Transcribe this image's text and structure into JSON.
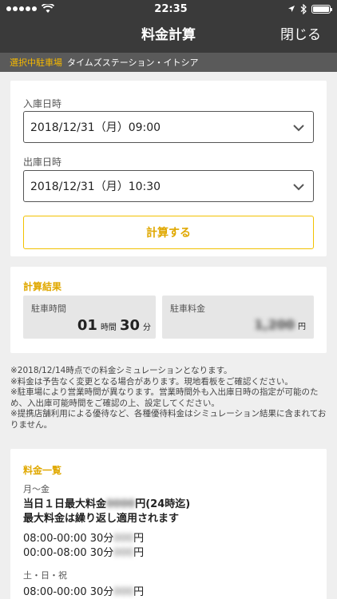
{
  "status_bar": {
    "time": "22:35"
  },
  "nav": {
    "title": "料金計算",
    "close_label": "閉じる"
  },
  "lot": {
    "tag": "選択中駐車場",
    "name": "タイムズステーション・イトシア"
  },
  "entry": {
    "label": "入庫日時",
    "value": "2018/12/31（月）09:00"
  },
  "exit": {
    "label": "出庫日時",
    "value": "2018/12/31（月）10:30"
  },
  "calc_button_label": "計算する",
  "result": {
    "title": "計算結果",
    "duration_label": "駐車時間",
    "hours": "01",
    "hours_unit": "時間",
    "minutes": "30",
    "minutes_unit": "分",
    "fee_label": "駐車料金",
    "fee_value": "1,200",
    "fee_unit": "円"
  },
  "notes": [
    "※2018/12/14時点での料金シミュレーションとなります。",
    "※料金は予告なく変更となる場合があります。現地看板をご確認ください。",
    "※駐車場により営業時間が異なります。営業時間外も入出庫日時の指定が可能のため、入出庫可能時間をご確認の上、設定してください。",
    "※提携店舗利用による優待など、各種優待料金はシミュレーション結果に含まれておりません。"
  ],
  "price_list": {
    "title": "料金一覧",
    "weekday_label": "月〜金",
    "max_prefix": "当日１日最大料金",
    "max_amount": "0000",
    "max_suffix": "円(24時迄)",
    "repeat_note": "最大料金は繰り返し適用されます",
    "rate1_prefix": "08:00-00:00 30分",
    "rate1_amount": "000",
    "rate1_suffix": "円",
    "rate2_prefix": "00:00-08:00 30分",
    "rate2_amount": "000",
    "rate2_suffix": "円",
    "weekend_label": "土・日・祝",
    "rate3_prefix": "08:00-00:00 30分",
    "rate3_amount": "000",
    "rate3_suffix": "円"
  },
  "colors": {
    "accent": "#e0a800",
    "header_bg": "#3a3a3a",
    "lot_bar_bg": "#5a5a5a"
  },
  "battery_level": 1.0
}
